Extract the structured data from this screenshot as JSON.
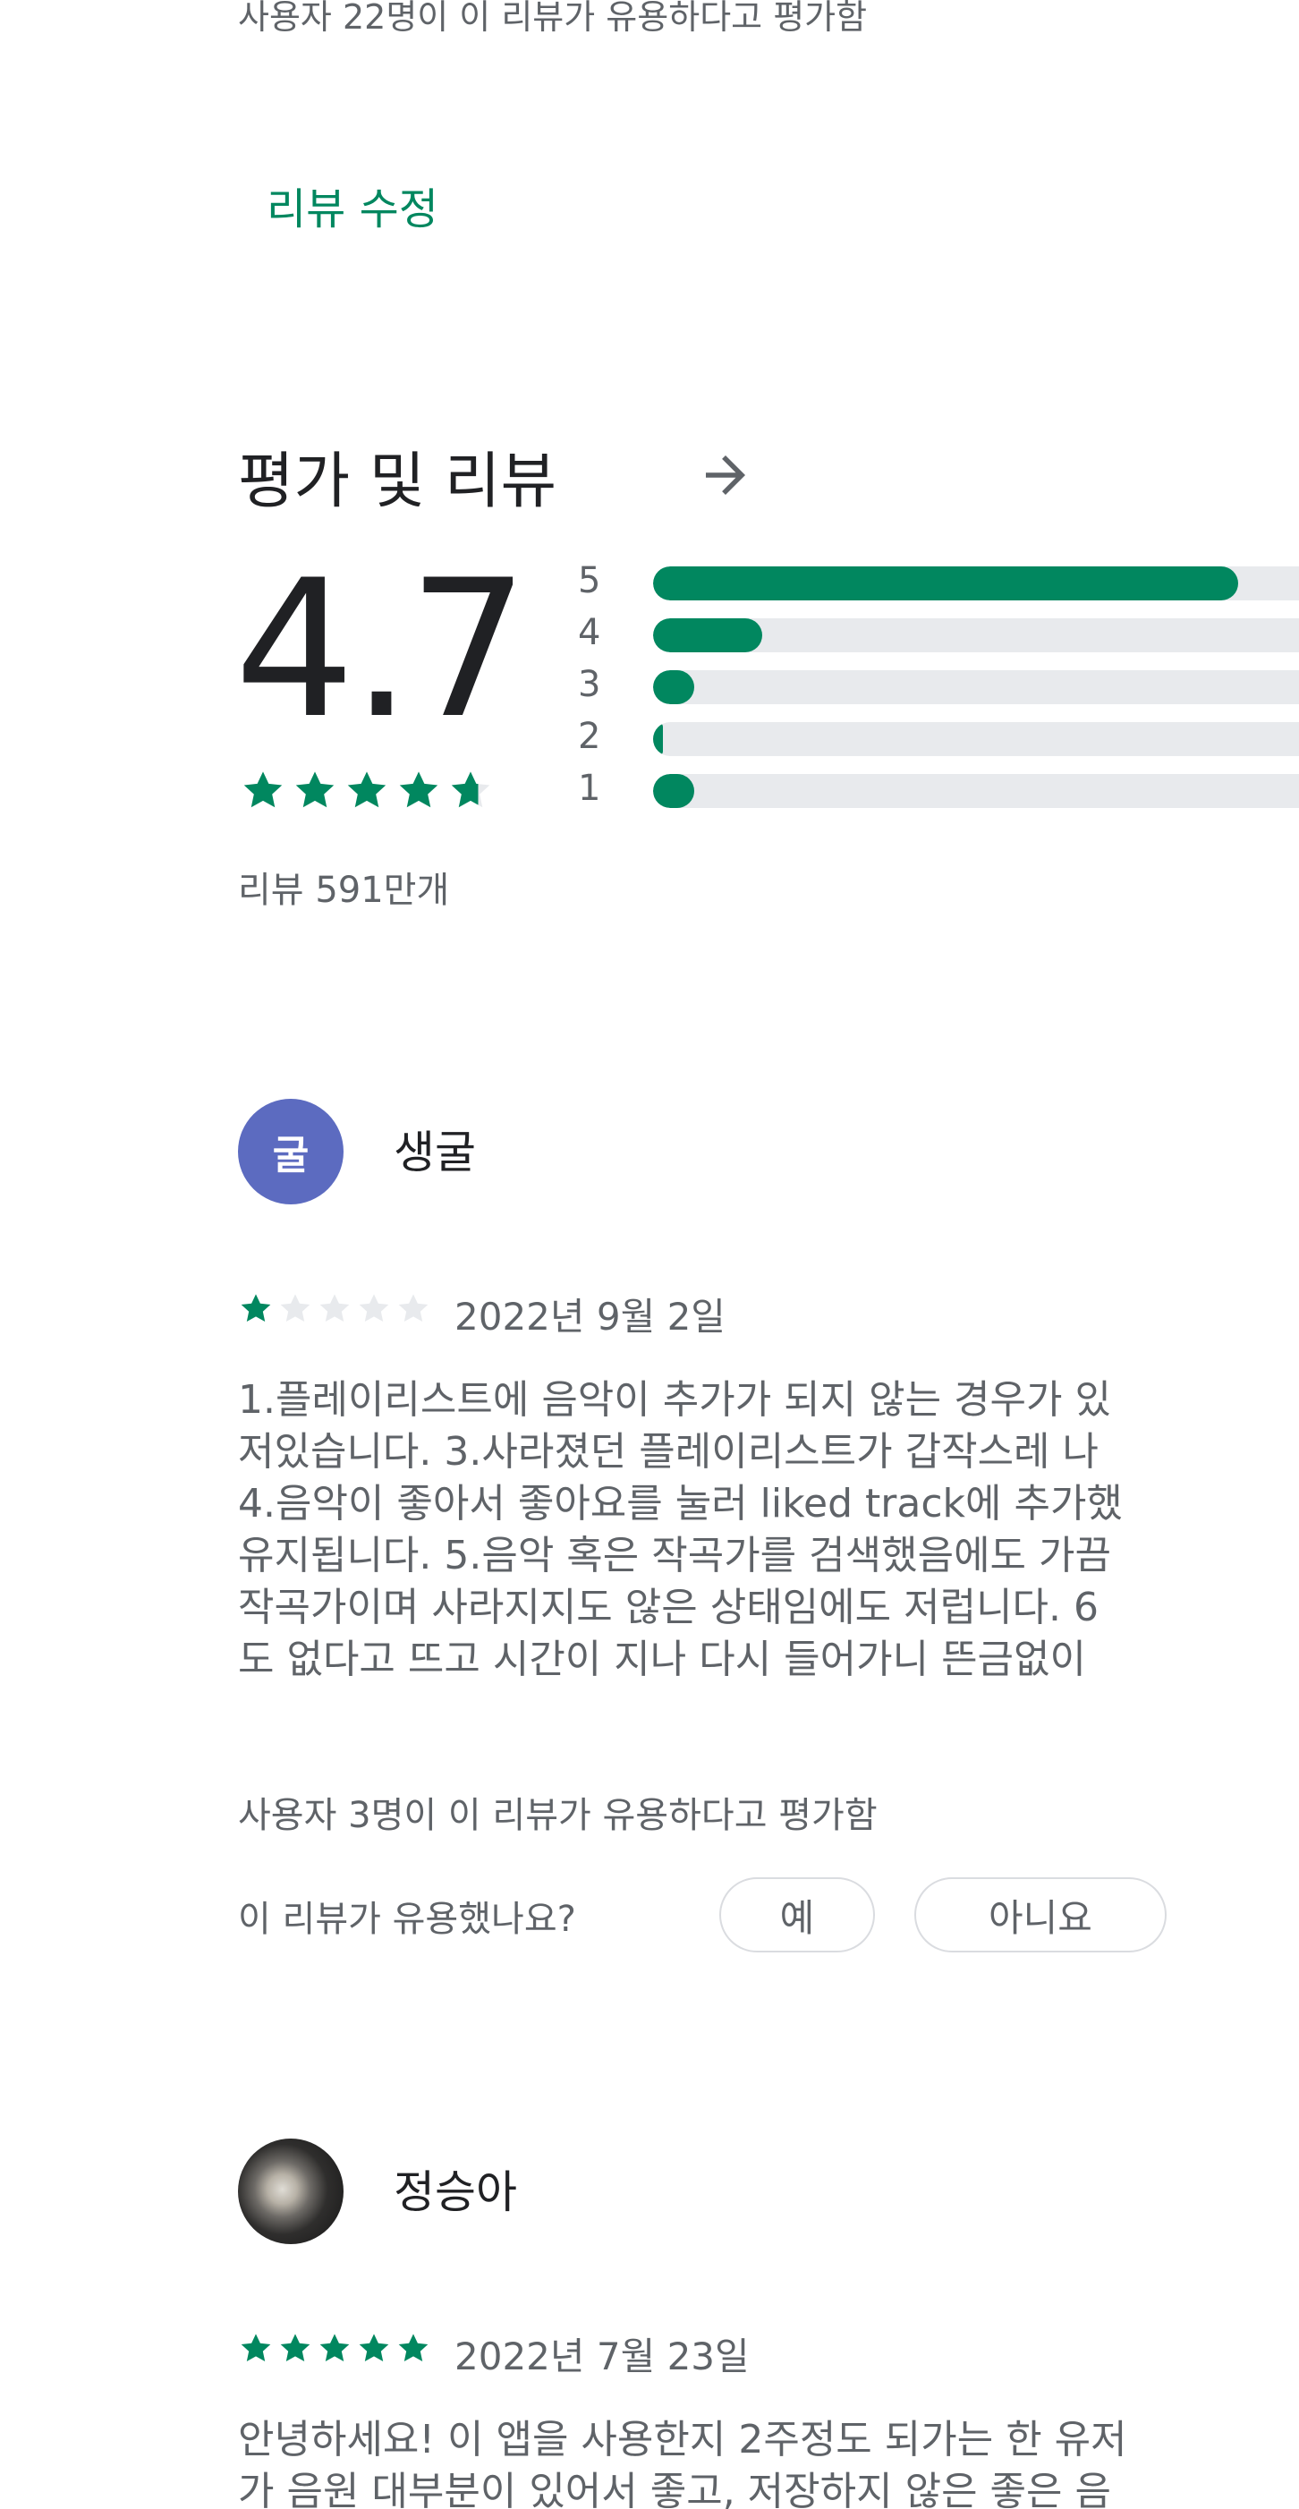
{
  "previous_review": {
    "helpful_text": "사용자 22명이 이 리뷰가 유용하다고 평가함",
    "edit_label": "리뷰 수정"
  },
  "ratings": {
    "section_title": "평가 및 리뷰",
    "arrow_icon": "arrow-right-icon",
    "average": "4.7",
    "average_stars": 4.7,
    "review_count": "리뷰 591만개",
    "accent_color": "#01875f",
    "track_color": "#e8eaed",
    "histogram": [
      {
        "label": "5",
        "fraction": 0.86
      },
      {
        "label": "4",
        "fraction": 0.16
      },
      {
        "label": "3",
        "fraction": 0.06
      },
      {
        "label": "2",
        "fraction": 0.015
      },
      {
        "label": "1",
        "fraction": 0.06
      }
    ]
  },
  "reviews": [
    {
      "avatar_initial": "굴",
      "avatar_color": "#5c6bc0",
      "name": "생굴",
      "stars": 1,
      "date": "2022년 9월 2일",
      "text_lines": [
        "1.플레이리스트에 음악이 추가가 되지 않는 경우가 있",
        "저있습니다. 3.사라졌던 플레이리스트가 갑작스레 나",
        "4.음악이 좋아서 좋아요를 눌러 liked track에 추가했",
        "유지됩니다. 5.음악 혹은 작곡가를 검색했음에도 가끔",
        "작곡가이며 사라지지도 않은 상태임에도 저럽니다. 6",
        "도 없다고 뜨고 시간이 지나 다시 들어가니 뜬금없이"
      ],
      "helpful_text": "사용자 3명이 이 리뷰가 유용하다고 평가함",
      "helpful_question": "이 리뷰가 유용했나요?",
      "yes_label": "예",
      "no_label": "아니요"
    },
    {
      "avatar_type": "photo",
      "name": "정승아",
      "stars": 5,
      "date": "2022년 7월 23일",
      "text_lines": [
        "안녕하세요! 이 앱을 사용한지 2주정도 되가는 한 유저",
        "가 음원 대부분이 있어서 좋고, 저장하지 않은 좋은 음"
      ]
    }
  ]
}
